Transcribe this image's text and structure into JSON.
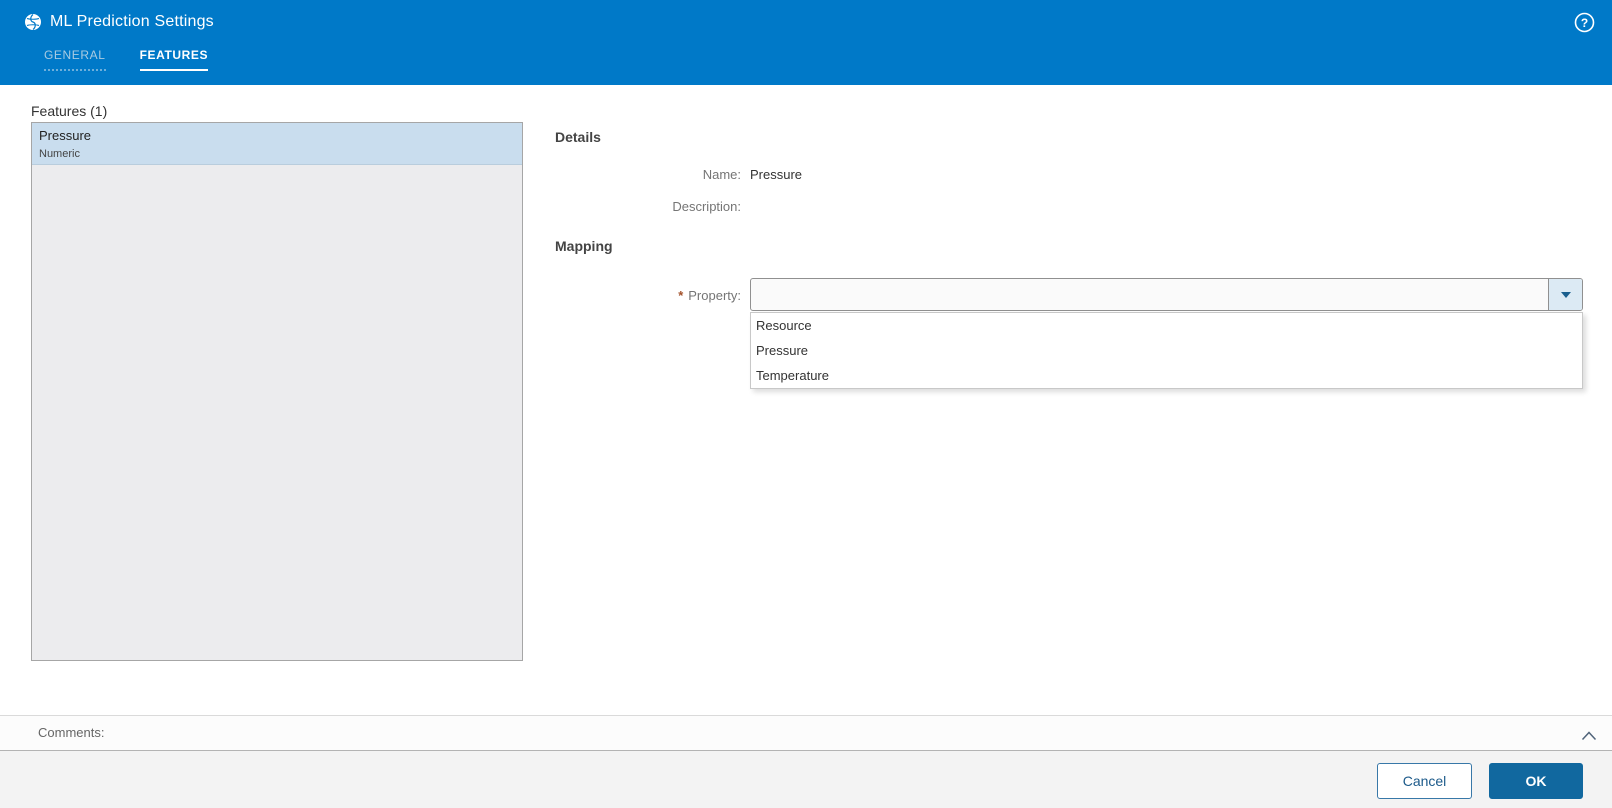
{
  "header": {
    "title": "ML Prediction Settings",
    "help_glyph": "?",
    "tabs": [
      {
        "label": "GENERAL",
        "active": false
      },
      {
        "label": "FEATURES",
        "active": true
      }
    ]
  },
  "features_panel": {
    "title": "Features (1)",
    "items": [
      {
        "name": "Pressure",
        "type": "Numeric",
        "selected": true
      }
    ]
  },
  "details": {
    "heading": "Details",
    "name_label": "Name:",
    "name_value": "Pressure",
    "description_label": "Description:",
    "description_value": ""
  },
  "mapping": {
    "heading": "Mapping",
    "required_marker": "*",
    "property_label": "Property:",
    "property_value": "",
    "options": [
      "Resource",
      "Pressure",
      "Temperature"
    ]
  },
  "footer": {
    "comments_label": "Comments:",
    "cancel_label": "Cancel",
    "ok_label": "OK"
  },
  "icons": {
    "app": "brain-icon",
    "help": "help-circle-icon",
    "combobox": "chevron-down-icon",
    "comments_toggle": "chevron-up-icon"
  },
  "colors": {
    "header_bg": "#0079c8",
    "tab_active_text": "#ffffff",
    "tab_inactive_text": "#a9cbe2",
    "selected_item_bg": "#c9ddee",
    "list_bg": "#ececee",
    "required_asterisk": "#a3512b",
    "dropdown_button_bg": "#dceaf4",
    "ok_button_bg": "#11689f",
    "cancel_button_border": "#3878a8",
    "footer_bg": "#f3f3f3"
  }
}
